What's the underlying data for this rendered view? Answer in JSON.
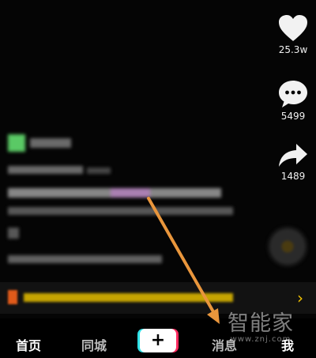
{
  "actions": {
    "likes": "25.3w",
    "comments": "5499",
    "shares": "1489"
  },
  "nav": {
    "home": "首页",
    "city": "同城",
    "create": "+",
    "messages": "消息",
    "me": "我"
  },
  "banner": {
    "chevron": "›"
  },
  "watermark": {
    "name": "智能家",
    "url": "www.znj.com"
  },
  "colors": {
    "accent_yellow": "#d9b400",
    "arrow_orange": "#e9963c",
    "plus_cyan": "#2fe0e6",
    "plus_red": "#ff2a5f"
  },
  "icons": [
    "heart-icon",
    "comment-bubble-icon",
    "share-arrow-icon",
    "music-disc-icon",
    "chevron-right-icon"
  ]
}
